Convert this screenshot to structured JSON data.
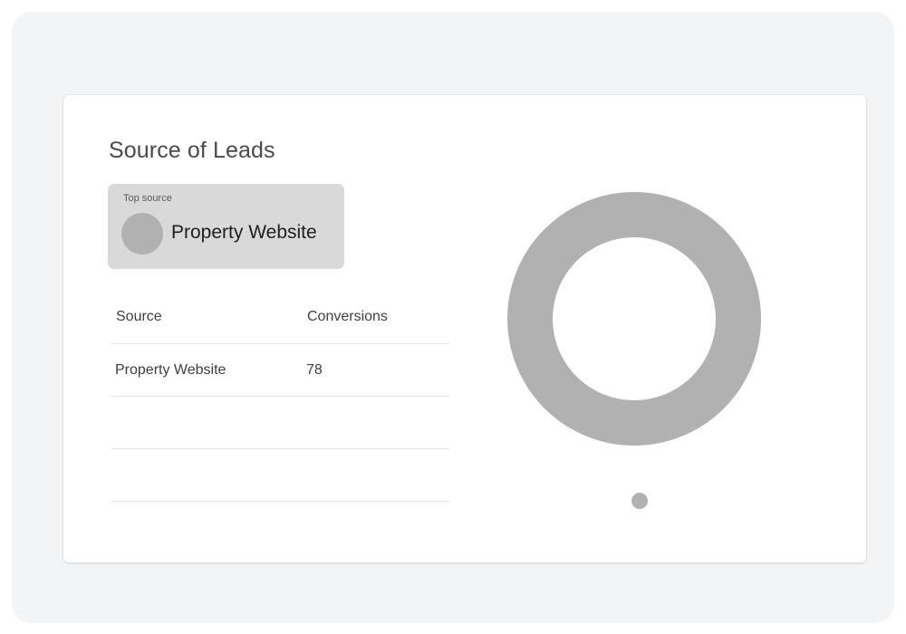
{
  "card": {
    "title": "Source of Leads"
  },
  "top_source": {
    "label": "Top source",
    "name": "Property Website"
  },
  "table": {
    "headers": [
      "Source",
      "Conversions"
    ],
    "rows": [
      {
        "source": "Property Website",
        "conversions": "78"
      }
    ]
  },
  "chart_data": {
    "type": "pie",
    "categories": [
      "Property Website"
    ],
    "values": [
      78
    ],
    "colors": [
      "#b1b1b1"
    ]
  }
}
